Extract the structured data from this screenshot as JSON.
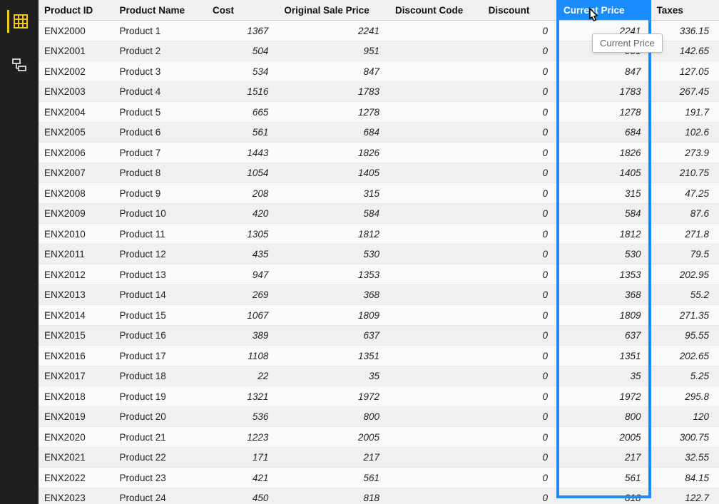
{
  "sidebar": {
    "tool_table_title": "Data",
    "tool_model_title": "Model"
  },
  "tooltip": {
    "text": "Current Price"
  },
  "headers": {
    "product_id": "Product ID",
    "product_name": "Product Name",
    "cost": "Cost",
    "orig_price": "Original Sale Price",
    "disc_code": "Discount Code",
    "discount": "Discount",
    "current_price": "Current Price",
    "taxes": "Taxes"
  },
  "selected_column": "current_price",
  "rows": [
    {
      "id": "ENX2000",
      "name": "Product 1",
      "cost": "1367",
      "orig": "2241",
      "code": "",
      "disc": "0",
      "cur": "2241",
      "tax": "336.15"
    },
    {
      "id": "ENX2001",
      "name": "Product 2",
      "cost": "504",
      "orig": "951",
      "code": "",
      "disc": "0",
      "cur": "951",
      "tax": "142.65"
    },
    {
      "id": "ENX2002",
      "name": "Product 3",
      "cost": "534",
      "orig": "847",
      "code": "",
      "disc": "0",
      "cur": "847",
      "tax": "127.05"
    },
    {
      "id": "ENX2003",
      "name": "Product 4",
      "cost": "1516",
      "orig": "1783",
      "code": "",
      "disc": "0",
      "cur": "1783",
      "tax": "267.45"
    },
    {
      "id": "ENX2004",
      "name": "Product 5",
      "cost": "665",
      "orig": "1278",
      "code": "",
      "disc": "0",
      "cur": "1278",
      "tax": "191.7"
    },
    {
      "id": "ENX2005",
      "name": "Product 6",
      "cost": "561",
      "orig": "684",
      "code": "",
      "disc": "0",
      "cur": "684",
      "tax": "102.6"
    },
    {
      "id": "ENX2006",
      "name": "Product 7",
      "cost": "1443",
      "orig": "1826",
      "code": "",
      "disc": "0",
      "cur": "1826",
      "tax": "273.9"
    },
    {
      "id": "ENX2007",
      "name": "Product 8",
      "cost": "1054",
      "orig": "1405",
      "code": "",
      "disc": "0",
      "cur": "1405",
      "tax": "210.75"
    },
    {
      "id": "ENX2008",
      "name": "Product 9",
      "cost": "208",
      "orig": "315",
      "code": "",
      "disc": "0",
      "cur": "315",
      "tax": "47.25"
    },
    {
      "id": "ENX2009",
      "name": "Product 10",
      "cost": "420",
      "orig": "584",
      "code": "",
      "disc": "0",
      "cur": "584",
      "tax": "87.6"
    },
    {
      "id": "ENX2010",
      "name": "Product 11",
      "cost": "1305",
      "orig": "1812",
      "code": "",
      "disc": "0",
      "cur": "1812",
      "tax": "271.8"
    },
    {
      "id": "ENX2011",
      "name": "Product 12",
      "cost": "435",
      "orig": "530",
      "code": "",
      "disc": "0",
      "cur": "530",
      "tax": "79.5"
    },
    {
      "id": "ENX2012",
      "name": "Product 13",
      "cost": "947",
      "orig": "1353",
      "code": "",
      "disc": "0",
      "cur": "1353",
      "tax": "202.95"
    },
    {
      "id": "ENX2013",
      "name": "Product 14",
      "cost": "269",
      "orig": "368",
      "code": "",
      "disc": "0",
      "cur": "368",
      "tax": "55.2"
    },
    {
      "id": "ENX2014",
      "name": "Product 15",
      "cost": "1067",
      "orig": "1809",
      "code": "",
      "disc": "0",
      "cur": "1809",
      "tax": "271.35"
    },
    {
      "id": "ENX2015",
      "name": "Product 16",
      "cost": "389",
      "orig": "637",
      "code": "",
      "disc": "0",
      "cur": "637",
      "tax": "95.55"
    },
    {
      "id": "ENX2016",
      "name": "Product 17",
      "cost": "1108",
      "orig": "1351",
      "code": "",
      "disc": "0",
      "cur": "1351",
      "tax": "202.65"
    },
    {
      "id": "ENX2017",
      "name": "Product 18",
      "cost": "22",
      "orig": "35",
      "code": "",
      "disc": "0",
      "cur": "35",
      "tax": "5.25"
    },
    {
      "id": "ENX2018",
      "name": "Product 19",
      "cost": "1321",
      "orig": "1972",
      "code": "",
      "disc": "0",
      "cur": "1972",
      "tax": "295.8"
    },
    {
      "id": "ENX2019",
      "name": "Product 20",
      "cost": "536",
      "orig": "800",
      "code": "",
      "disc": "0",
      "cur": "800",
      "tax": "120"
    },
    {
      "id": "ENX2020",
      "name": "Product 21",
      "cost": "1223",
      "orig": "2005",
      "code": "",
      "disc": "0",
      "cur": "2005",
      "tax": "300.75"
    },
    {
      "id": "ENX2021",
      "name": "Product 22",
      "cost": "171",
      "orig": "217",
      "code": "",
      "disc": "0",
      "cur": "217",
      "tax": "32.55"
    },
    {
      "id": "ENX2022",
      "name": "Product 23",
      "cost": "421",
      "orig": "561",
      "code": "",
      "disc": "0",
      "cur": "561",
      "tax": "84.15"
    },
    {
      "id": "ENX2023",
      "name": "Product 24",
      "cost": "450",
      "orig": "818",
      "code": "",
      "disc": "0",
      "cur": "818",
      "tax": "122.7"
    }
  ]
}
